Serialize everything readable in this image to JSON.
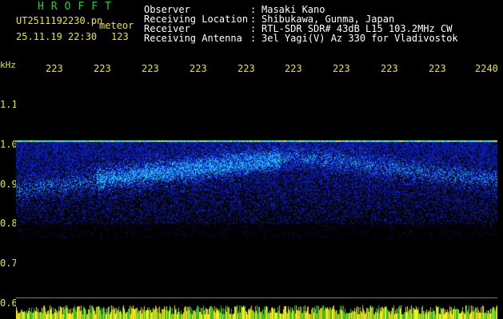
{
  "header": {
    "app_title": "HROFFT",
    "filename": "UT2511192230.pn",
    "mode": "meteor",
    "datetime": "25.11.19 22:30",
    "count": "123",
    "info": [
      {
        "label": "Observer",
        "value": "Masaki Kano"
      },
      {
        "label": "Receiving Location",
        "value": "Shibukawa, Gunma, Japan"
      },
      {
        "label": "Receiver",
        "value": "RTL-SDR SDR# 43dB L15 103.2MHz CW"
      },
      {
        "label": "Receiving Antenna",
        "value": "3el Yagi(V) Az 330 for Vladivostok"
      }
    ]
  },
  "chart_data": {
    "type": "heatmap",
    "ylabel": "kHz",
    "yticks": [
      "1.1",
      "1.0",
      "0.9",
      "0.8",
      "0.7",
      "0.6"
    ],
    "ylim": [
      0.6,
      1.1
    ],
    "xticks": [
      "223",
      "223",
      "223",
      "223",
      "223",
      "223",
      "223",
      "223",
      "223",
      "2240"
    ],
    "carrier_khz": 1.01,
    "echo_band_khz": [
      0.8,
      1.01
    ],
    "colors": {
      "background": "#000000",
      "noise_dark": "#0a1a8c",
      "noise_mid": "#1c50e0",
      "noise_bright": "#2ad0e0",
      "hot": "#f0e040",
      "axis_text": "#e8e820",
      "grid": "#8a8a8a"
    }
  }
}
